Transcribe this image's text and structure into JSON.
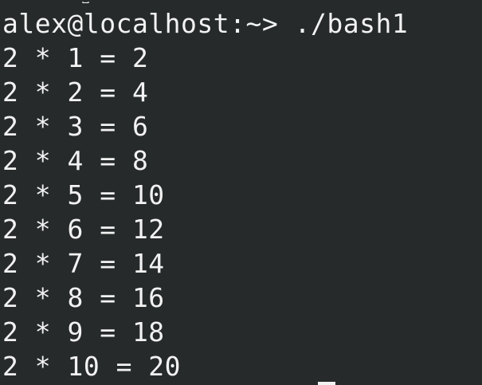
{
  "terminal": {
    "prompt": "alex@localhost:~>",
    "command": "./bash1",
    "prompt_line": "alex@localhost:~> ./bash1",
    "output": [
      "2 * 1 = 2",
      "2 * 2 = 4",
      "2 * 3 = 6",
      "2 * 4 = 8",
      "2 * 5 = 10",
      "2 * 6 = 12",
      "2 * 7 = 14",
      "2 * 8 = 16",
      "2 * 9 = 18",
      "2 * 10 = 20"
    ]
  },
  "colors": {
    "background": "#262a2b",
    "foreground": "#f2f2f2"
  }
}
